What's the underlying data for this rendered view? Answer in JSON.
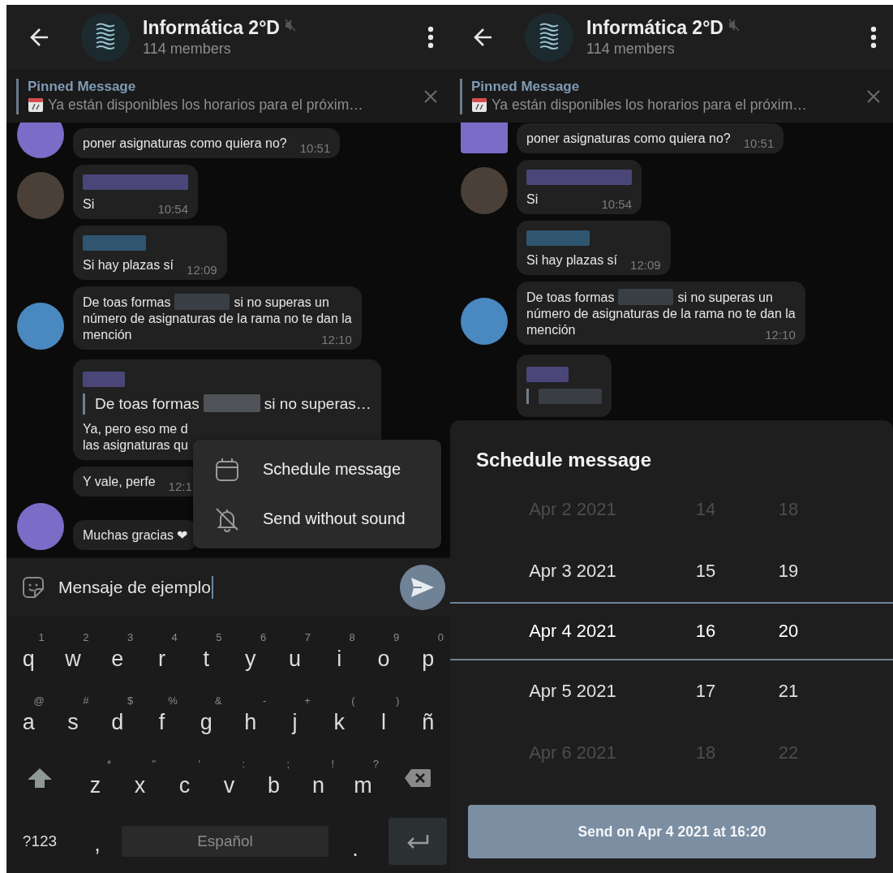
{
  "screens": [
    {
      "header": {
        "title": "Informática 2°D",
        "muted": true,
        "subtitle": "114 members"
      },
      "pinned": {
        "title": "Pinned Message",
        "text": "Ya están disponibles los horarios para el próxim…"
      },
      "messages": [
        {
          "kind": "round_avatar",
          "parts": [
            {
              "kind": "text",
              "text": "poner asignaturas como quiera no?"
            }
          ],
          "time": "10:51"
        },
        {
          "kind": "round_avatar",
          "has_sender": true,
          "parts": [
            {
              "kind": "text",
              "text": "Si"
            }
          ],
          "time": "10:54"
        },
        {
          "kind": "plain",
          "has_sender": true,
          "parts": [
            {
              "kind": "text",
              "text": "Si hay plazas sí"
            }
          ],
          "time": "12:09"
        },
        {
          "kind": "round_avatar",
          "parts": [
            {
              "kind": "text",
              "text": "De toas formas"
            },
            {
              "kind": "redacted"
            },
            {
              "kind": "text",
              "text": "si no superas un"
            },
            {
              "kind": "break"
            },
            {
              "kind": "text",
              "text": "número de asignaturas de la rama no te dan la"
            },
            {
              "kind": "break"
            },
            {
              "kind": "text",
              "text": "mención"
            }
          ],
          "time": "12:10"
        },
        {
          "kind": "plain",
          "has_sender": true,
          "quote": {
            "parts": [
              {
                "kind": "text",
                "text": "De toas formas"
              },
              {
                "kind": "redacted"
              },
              {
                "kind": "text",
                "text": "si no superas…"
              }
            ]
          },
          "parts": [
            {
              "kind": "text",
              "text": "Ya, pero eso me d"
            },
            {
              "kind": "break"
            },
            {
              "kind": "text",
              "text": "las asignaturas qu"
            }
          ]
        },
        {
          "kind": "plain",
          "parts": [
            {
              "kind": "text",
              "text": "Y vale, perfe"
            }
          ],
          "time": "12:1"
        },
        {
          "kind": "round_avatar",
          "parts": [
            {
              "kind": "text",
              "text": "Muchas gracias ❤"
            }
          ]
        }
      ],
      "menu": {
        "items": [
          {
            "kind": "schedule",
            "label": "Schedule message"
          },
          {
            "kind": "silent",
            "label": "Send without sound"
          }
        ]
      },
      "composer": {
        "value": "Mensaje de ejemplo"
      },
      "keyboard": {
        "rows": [
          {
            "keys": [
              {
                "kind": "char",
                "label": "q",
                "hint": "1"
              },
              {
                "kind": "char",
                "label": "w",
                "hint": "2"
              },
              {
                "kind": "char",
                "label": "e",
                "hint": "3"
              },
              {
                "kind": "char",
                "label": "r",
                "hint": "4"
              },
              {
                "kind": "char",
                "label": "t",
                "hint": "5"
              },
              {
                "kind": "char",
                "label": "y",
                "hint": "6"
              },
              {
                "kind": "char",
                "label": "u",
                "hint": "7"
              },
              {
                "kind": "char",
                "label": "i",
                "hint": "8"
              },
              {
                "kind": "char",
                "label": "o",
                "hint": "9"
              },
              {
                "kind": "char",
                "label": "p",
                "hint": "0"
              }
            ]
          },
          {
            "keys": [
              {
                "kind": "char",
                "label": "a",
                "hint": "@"
              },
              {
                "kind": "char",
                "label": "s",
                "hint": "#"
              },
              {
                "kind": "char",
                "label": "d",
                "hint": "$"
              },
              {
                "kind": "char",
                "label": "f",
                "hint": "%"
              },
              {
                "kind": "char",
                "label": "g",
                "hint": "&"
              },
              {
                "kind": "char",
                "label": "h",
                "hint": "-"
              },
              {
                "kind": "char",
                "label": "j",
                "hint": "+"
              },
              {
                "kind": "char",
                "label": "k",
                "hint": "("
              },
              {
                "kind": "char",
                "label": "l",
                "hint": ")"
              },
              {
                "kind": "char",
                "label": "ñ"
              }
            ]
          },
          {
            "keys": [
              {
                "kind": "shift"
              },
              {
                "kind": "char",
                "label": "z",
                "hint": "*"
              },
              {
                "kind": "char",
                "label": "x",
                "hint": "\""
              },
              {
                "kind": "char",
                "label": "c",
                "hint": "'"
              },
              {
                "kind": "char",
                "label": "v",
                "hint": ":"
              },
              {
                "kind": "char",
                "label": "b",
                "hint": ";"
              },
              {
                "kind": "char",
                "label": "n",
                "hint": "!"
              },
              {
                "kind": "char",
                "label": "m",
                "hint": "?"
              },
              {
                "kind": "backspace"
              }
            ]
          },
          {
            "keys": [
              {
                "kind": "char",
                "label": "?123"
              },
              {
                "kind": "char",
                "label": ","
              },
              {
                "kind": "space",
                "label": "Español"
              },
              {
                "kind": "char",
                "label": "."
              },
              {
                "kind": "enter"
              }
            ]
          }
        ]
      }
    },
    {
      "header": {
        "title": "Informática 2°D",
        "muted": true,
        "subtitle": "114 members"
      },
      "pinned": {
        "title": "Pinned Message",
        "text": "Ya están disponibles los horarios para el próxim…"
      },
      "messages": [
        {
          "kind": "square_avatar",
          "parts": [
            {
              "kind": "text",
              "text": "poner asignaturas como quiera no?"
            }
          ],
          "time": "10:51"
        },
        {
          "kind": "round_avatar",
          "has_sender": true,
          "parts": [
            {
              "kind": "text",
              "text": "Si"
            }
          ],
          "time": "10:54"
        },
        {
          "kind": "plain",
          "has_sender": true,
          "parts": [
            {
              "kind": "text",
              "text": "Si hay plazas sí"
            }
          ],
          "time": "12:09"
        },
        {
          "kind": "round_avatar",
          "parts": [
            {
              "kind": "text",
              "text": "De toas formas"
            },
            {
              "kind": "redacted"
            },
            {
              "kind": "text",
              "text": "si no superas un"
            },
            {
              "kind": "break"
            },
            {
              "kind": "text",
              "text": "número de asignaturas de la rama no te dan la"
            },
            {
              "kind": "break"
            },
            {
              "kind": "text",
              "text": "mención"
            }
          ],
          "time": "12:10"
        },
        {
          "kind": "plain",
          "has_sender": true,
          "quote": {
            "has_sender": true
          }
        }
      ],
      "scheduler": {
        "title": "Schedule message",
        "rows": [
          {
            "date": "Apr 2 2021",
            "hour": "14",
            "minute": "18",
            "selected": false
          },
          {
            "date": "Apr 3 2021",
            "hour": "15",
            "minute": "19",
            "selected": false
          },
          {
            "date": "Apr 4 2021",
            "hour": "16",
            "minute": "20",
            "selected": true
          },
          {
            "date": "Apr 5 2021",
            "hour": "17",
            "minute": "21",
            "selected": false
          },
          {
            "date": "Apr 6 2021",
            "hour": "18",
            "minute": "22",
            "selected": false
          }
        ],
        "button": "Send on Apr 4 2021 at 16:20"
      }
    }
  ]
}
